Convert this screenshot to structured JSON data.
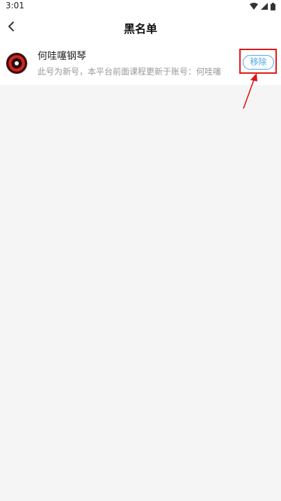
{
  "status_bar": {
    "time": "3:01"
  },
  "header": {
    "title": "黑名单"
  },
  "blacklist": {
    "items": [
      {
        "name": "何哇噻钢琴",
        "description": "此号为新号，本平台前面课程更新于账号：何哇噻",
        "action_label": "移除"
      }
    ]
  },
  "colors": {
    "accent": "#4aa8e8",
    "annotation": "#e01515",
    "background": "#f5f5f5"
  }
}
